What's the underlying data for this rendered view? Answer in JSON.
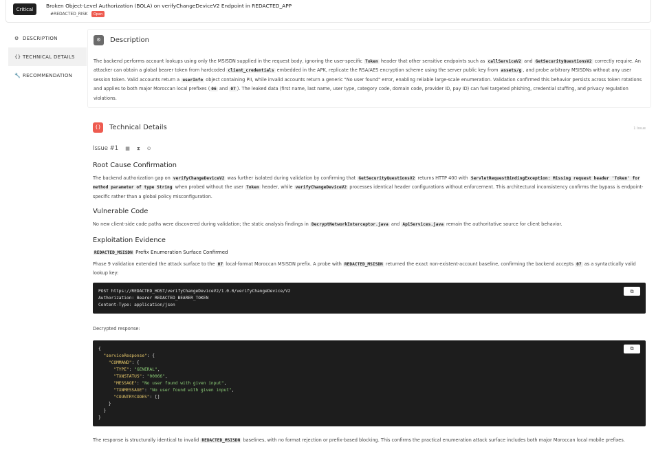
{
  "header": {
    "severity": "Critical",
    "title": "Broken Object-Level Authorization (BOLA) on verifyChangeDeviceV2 Endpoint in REDACTED_APP",
    "risk_tag": "#REDACTED_RISK",
    "status": "Open"
  },
  "sidebar": {
    "items": [
      {
        "label": "DESCRIPTION",
        "icon": "gear-icon"
      },
      {
        "label": "TECHNICAL DETAILS",
        "icon": "code-braces-icon"
      },
      {
        "label": "RECOMMENDATION",
        "icon": "wrench-icon"
      }
    ]
  },
  "description": {
    "title": "Description",
    "t1": "The backend performs account lookups using only the MSISDN supplied in the request body, ignoring the user-specific ",
    "c1": "Token",
    "t2": " header that other sensitive endpoints such as ",
    "c2": "callServiceV2",
    "t3": " and ",
    "c3": "GetSecurityQuestionsV2",
    "t4": " correctly require. An attacker can obtain a global bearer token from hardcoded ",
    "c4": "client_credentials",
    "t5": " embedded in the APK, replicate the RSA/AES encryption scheme using the server public key from ",
    "c5": "assets/g",
    "t6": ", and probe arbitrary MSISDNs without any user session token. Valid accounts return a ",
    "c6": "userInfo",
    "t7": " object containing PII, while invalid accounts return a generic \"No user found\" error, enabling reliable large-scale enumeration. Validation confirmed this behavior persists across token rotations and applies to both major Moroccan local prefixes (",
    "c7": "06",
    "t8": " and ",
    "c8": "07",
    "t9": "). The leaked data (first name, last name, user type, category code, domain code, provider ID, pay ID) can fuel targeted phishing, credential stuffing, and privacy regulation violations."
  },
  "technical": {
    "title": "Technical Details",
    "issue_count": "1 Issue",
    "issue_label": "Issue #1",
    "root_cause": {
      "heading": "Root Cause Confirmation",
      "t1": "The backend authorization gap on ",
      "c1": "verifyChangeDeviceV2",
      "t2": " was further isolated during validation by confirming that ",
      "c2": "GetSecurityQuestionsV2",
      "t3": " returns HTTP 400 with ",
      "c3": "ServletRequestBindingException: Missing request header 'Token' for method parameter of type String",
      "t4": " when probed without the user ",
      "c4": "Token",
      "t5": " header, while ",
      "c5": "verifyChangeDeviceV2",
      "t6": " processes identical header configurations without enforcement. This architectural inconsistency confirms the bypass is endpoint-specific rather than a global policy misconfiguration."
    },
    "vulnerable_code": {
      "heading": "Vulnerable Code",
      "t1": "No new client-side code paths were discovered during validation; the static analysis findings in ",
      "c1": "DecryptNetworkInterceptor.java",
      "t2": " and ",
      "c2": "ApiServices.java",
      "t3": " remain the authoritative source for client behavior."
    },
    "exploitation": {
      "heading": "Exploitation Evidence",
      "sub_code": "REDACTED_MSISDN",
      "sub_text": " Prefix Enumeration Surface Confirmed",
      "t1": "Phase 9 validation extended the attack surface to the ",
      "c1": "07",
      "t2": " local-format Moroccan MSISDN prefix. A probe with ",
      "c2": "REDACTED_MSISDN",
      "t3": " returned the exact non-existent-account baseline, confirming the backend accepts ",
      "c3": "07",
      "t4": " as a syntactically valid lookup key:",
      "request_lines": [
        "POST https://REDACTED_HOST/verifyChangeDeviceV2/1.0.0/verifyChangeDevice/V2",
        "Authorization: Bearer REDACTED_BEARER_TOKEN",
        "Content-Type: application/json"
      ],
      "decrypted_label": "Decrypted response:",
      "response": {
        "k_service": "\"serviceResponse\"",
        "k_command": "\"COMMAND\"",
        "k_type": "\"TYPE\"",
        "v_type": "\"GENERAL\"",
        "k_txnstatus": "\"TXNSTATUS\"",
        "v_txnstatus": "\"00066\"",
        "k_message": "\"MESSAGE\"",
        "v_message": "\"No user found with given input\"",
        "k_txnmessage": "\"TXNMESSAGE\"",
        "v_txnmessage": "\"No user found with given input\"",
        "k_countrycodes": "\"COUNTRYCODES\"",
        "v_countrycodes": "[]"
      },
      "t5": "The response is structurally identical to invalid ",
      "c5": "REDACTED_MSISDN",
      "t6": " baselines, with no format rejection or prefix-based blocking. This confirms the practical enumeration attack surface includes both major Moroccan local mobile prefixes."
    }
  },
  "colors": {
    "description_icon": "#6b6b6b",
    "technical_icon": "#ee5b50",
    "status_open": "#ee5b50",
    "code_bg": "#1d1d1d"
  }
}
